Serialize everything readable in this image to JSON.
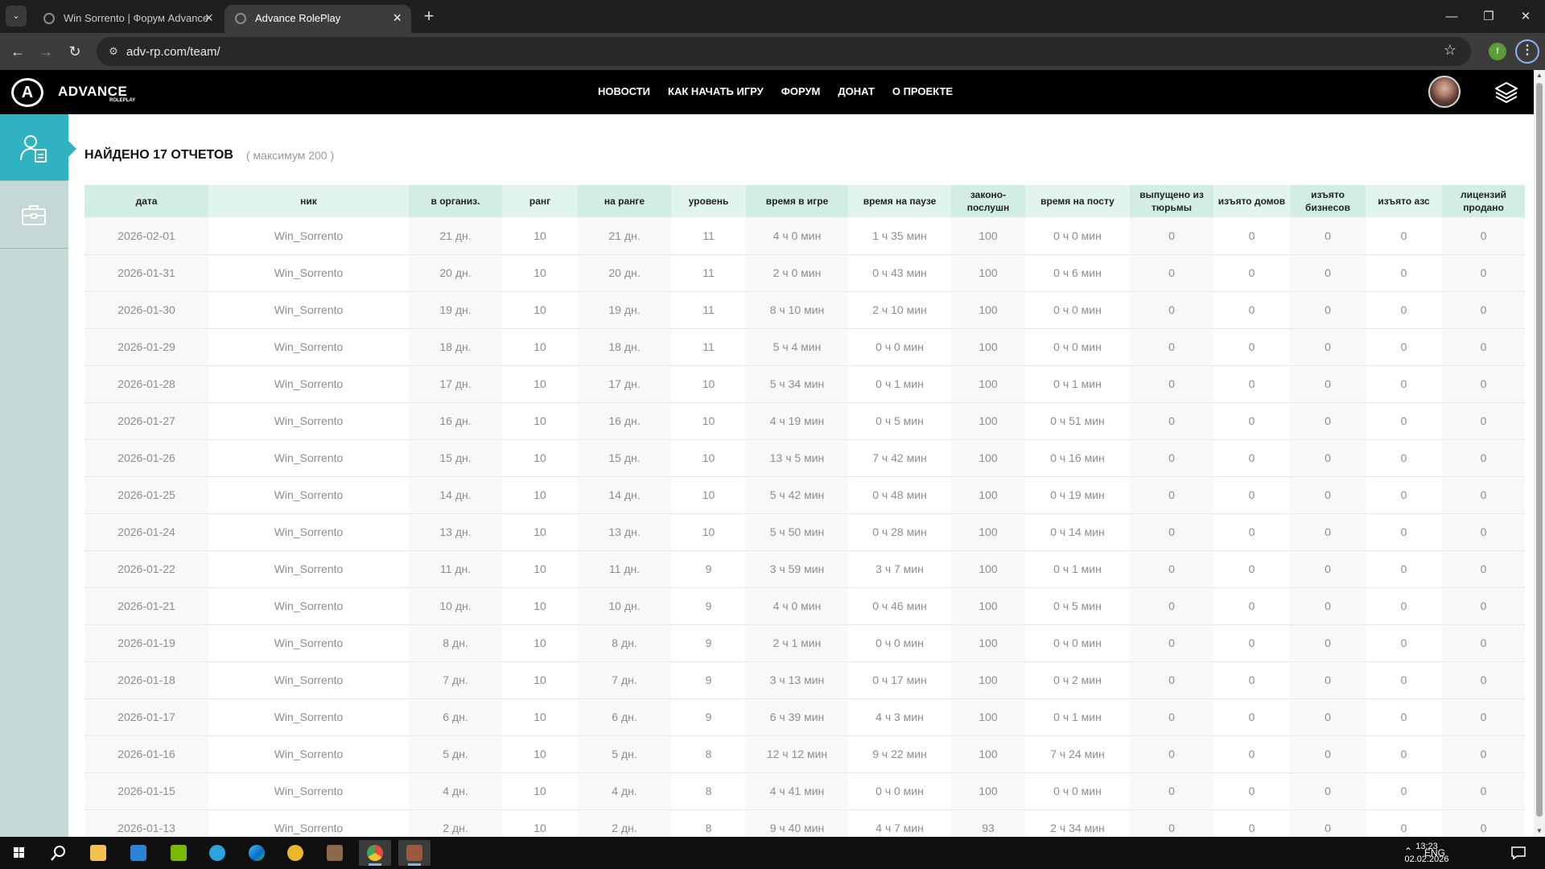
{
  "browser": {
    "tabs": [
      {
        "title": "Win Sorrento | Форум Advance",
        "active": false
      },
      {
        "title": "Advance RolePlay",
        "active": true
      }
    ],
    "url": "adv-rp.com/team/",
    "profile_initial": "f"
  },
  "site": {
    "logo_text": "ADVANCE",
    "logo_sub": "ROLEPLAY",
    "logo_letter": "A",
    "nav": [
      "НОВОСТИ",
      "КАК НАЧАТЬ ИГРУ",
      "ФОРУМ",
      "ДОНАТ",
      "О ПРОЕКТЕ"
    ]
  },
  "sidebar": {
    "items": [
      {
        "icon": "user-report-icon",
        "active": true
      },
      {
        "icon": "briefcase-icon",
        "active": false
      }
    ]
  },
  "content": {
    "title": "НАЙДЕНО 17 ОТЧЕТОВ",
    "note": "( максимум 200 )"
  },
  "table": {
    "headers": [
      "дата",
      "ник",
      "в организ.",
      "ранг",
      "на ранге",
      "уровень",
      "время в игре",
      "время на паузе",
      "законо-послушн",
      "время на посту",
      "выпущено из тюрьмы",
      "изъято домов",
      "изъято бизнесов",
      "изъято азс",
      "лицензий продано"
    ],
    "rows": [
      [
        "2026-02-01",
        "Win_Sorrento",
        "21 дн.",
        "10",
        "21 дн.",
        "11",
        "4 ч 0 мин",
        "1 ч 35 мин",
        "100",
        "0 ч 0 мин",
        "0",
        "0",
        "0",
        "0",
        "0"
      ],
      [
        "2026-01-31",
        "Win_Sorrento",
        "20 дн.",
        "10",
        "20 дн.",
        "11",
        "2 ч 0 мин",
        "0 ч 43 мин",
        "100",
        "0 ч 6 мин",
        "0",
        "0",
        "0",
        "0",
        "0"
      ],
      [
        "2026-01-30",
        "Win_Sorrento",
        "19 дн.",
        "10",
        "19 дн.",
        "11",
        "8 ч 10 мин",
        "2 ч 10 мин",
        "100",
        "0 ч 0 мин",
        "0",
        "0",
        "0",
        "0",
        "0"
      ],
      [
        "2026-01-29",
        "Win_Sorrento",
        "18 дн.",
        "10",
        "18 дн.",
        "11",
        "5 ч 4 мин",
        "0 ч 0 мин",
        "100",
        "0 ч 0 мин",
        "0",
        "0",
        "0",
        "0",
        "0"
      ],
      [
        "2026-01-28",
        "Win_Sorrento",
        "17 дн.",
        "10",
        "17 дн.",
        "10",
        "5 ч 34 мин",
        "0 ч 1 мин",
        "100",
        "0 ч 1 мин",
        "0",
        "0",
        "0",
        "0",
        "0"
      ],
      [
        "2026-01-27",
        "Win_Sorrento",
        "16 дн.",
        "10",
        "16 дн.",
        "10",
        "4 ч 19 мин",
        "0 ч 5 мин",
        "100",
        "0 ч 51 мин",
        "0",
        "0",
        "0",
        "0",
        "0"
      ],
      [
        "2026-01-26",
        "Win_Sorrento",
        "15 дн.",
        "10",
        "15 дн.",
        "10",
        "13 ч 5 мин",
        "7 ч 42 мин",
        "100",
        "0 ч 16 мин",
        "0",
        "0",
        "0",
        "0",
        "0"
      ],
      [
        "2026-01-25",
        "Win_Sorrento",
        "14 дн.",
        "10",
        "14 дн.",
        "10",
        "5 ч 42 мин",
        "0 ч 48 мин",
        "100",
        "0 ч 19 мин",
        "0",
        "0",
        "0",
        "0",
        "0"
      ],
      [
        "2026-01-24",
        "Win_Sorrento",
        "13 дн.",
        "10",
        "13 дн.",
        "10",
        "5 ч 50 мин",
        "0 ч 28 мин",
        "100",
        "0 ч 14 мин",
        "0",
        "0",
        "0",
        "0",
        "0"
      ],
      [
        "2026-01-22",
        "Win_Sorrento",
        "11 дн.",
        "10",
        "11 дн.",
        "9",
        "3 ч 59 мин",
        "3 ч 7 мин",
        "100",
        "0 ч 1 мин",
        "0",
        "0",
        "0",
        "0",
        "0"
      ],
      [
        "2026-01-21",
        "Win_Sorrento",
        "10 дн.",
        "10",
        "10 дн.",
        "9",
        "4 ч 0 мин",
        "0 ч 46 мин",
        "100",
        "0 ч 5 мин",
        "0",
        "0",
        "0",
        "0",
        "0"
      ],
      [
        "2026-01-19",
        "Win_Sorrento",
        "8 дн.",
        "10",
        "8 дн.",
        "9",
        "2 ч 1 мин",
        "0 ч 0 мин",
        "100",
        "0 ч 0 мин",
        "0",
        "0",
        "0",
        "0",
        "0"
      ],
      [
        "2026-01-18",
        "Win_Sorrento",
        "7 дн.",
        "10",
        "7 дн.",
        "9",
        "3 ч 13 мин",
        "0 ч 17 мин",
        "100",
        "0 ч 2 мин",
        "0",
        "0",
        "0",
        "0",
        "0"
      ],
      [
        "2026-01-17",
        "Win_Sorrento",
        "6 дн.",
        "10",
        "6 дн.",
        "9",
        "6 ч 39 мин",
        "4 ч 3 мин",
        "100",
        "0 ч 1 мин",
        "0",
        "0",
        "0",
        "0",
        "0"
      ],
      [
        "2026-01-16",
        "Win_Sorrento",
        "5 дн.",
        "10",
        "5 дн.",
        "8",
        "12 ч 12 мин",
        "9 ч 22 мин",
        "100",
        "7 ч 24 мин",
        "0",
        "0",
        "0",
        "0",
        "0"
      ],
      [
        "2026-01-15",
        "Win_Sorrento",
        "4 дн.",
        "10",
        "4 дн.",
        "8",
        "4 ч 41 мин",
        "0 ч 0 мин",
        "100",
        "0 ч 0 мин",
        "0",
        "0",
        "0",
        "0",
        "0"
      ],
      [
        "2026-01-13",
        "Win_Sorrento",
        "2 дн.",
        "10",
        "2 дн.",
        "8",
        "9 ч 40 мин",
        "4 ч 7 мин",
        "93",
        "2 ч 34 мин",
        "0",
        "0",
        "0",
        "0",
        "0"
      ]
    ]
  },
  "taskbar": {
    "apps": [
      "start-icon",
      "search-icon",
      "file-explorer-icon",
      "store-icon",
      "nvidia-icon",
      "telegram-icon",
      "edge-icon",
      "winamp-icon",
      "game-icon",
      "chrome-icon",
      "game-launcher-icon"
    ],
    "language": "ENG",
    "time": "13:23",
    "date": "02.02.2026"
  },
  "colors": {
    "accent": "#30b2c0",
    "sidebar": "#c5d8d6",
    "header_bg": "#000000",
    "table_header": "#d7efe5"
  }
}
